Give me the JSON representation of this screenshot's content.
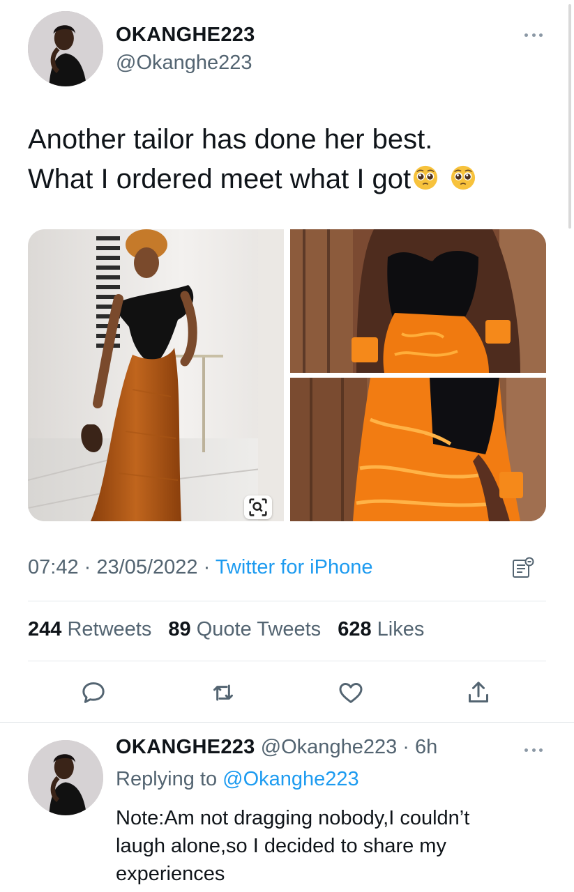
{
  "tweet": {
    "display_name": "OKANGHE223",
    "handle": "@Okanghe223",
    "text_line_1": "Another tailor has done her best.",
    "text_line_2": "What I ordered meet what I got",
    "emojis": [
      "pleading-face-emoji",
      "pleading-face-emoji"
    ],
    "photos": [
      {
        "name": "ordered-style-photo",
        "description_icon": "image"
      },
      {
        "name": "received-front-photo",
        "description_icon": "image"
      },
      {
        "name": "received-back-photo",
        "description_icon": "image"
      }
    ],
    "time": "07:42",
    "date": "23/05/2022",
    "source": "Twitter for iPhone",
    "separator": "·"
  },
  "stats": {
    "retweets_count": "244",
    "retweets_label": "Retweets",
    "quotes_count": "89",
    "quotes_label": "Quote Tweets",
    "likes_count": "628",
    "likes_label": "Likes"
  },
  "actions": [
    {
      "name": "reply",
      "icon": "comment-icon"
    },
    {
      "name": "retweet",
      "icon": "retweet-icon"
    },
    {
      "name": "like",
      "icon": "heart-icon"
    },
    {
      "name": "share",
      "icon": "share-icon"
    }
  ],
  "reply": {
    "display_name": "OKANGHE223",
    "handle": "@Okanghe223",
    "age": "6h",
    "replying_prefix": "Replying to",
    "replying_to": "@Okanghe223",
    "text_line_1": "Note:Am not dragging nobody,I couldn’t",
    "text_line_2": "laugh alone,so I decided to share my",
    "text_line_3": "experiences"
  },
  "colors": {
    "accent": "#1d9bf0",
    "secondary_text": "#536471",
    "primary_text": "#0f1419",
    "divider": "#e4e8eb"
  }
}
